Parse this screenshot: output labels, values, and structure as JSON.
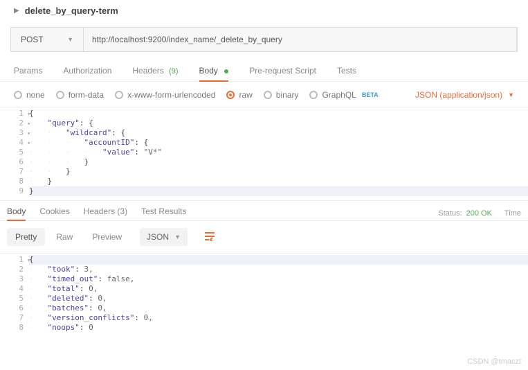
{
  "breadcrumb": {
    "title": "delete_by_query-term"
  },
  "request": {
    "method": "POST",
    "url": "http://localhost:9200/index_name/_delete_by_query"
  },
  "tabs": {
    "params": "Params",
    "auth": "Authorization",
    "headers": "Headers",
    "headers_count": "(9)",
    "body": "Body",
    "prerequest": "Pre-request Script",
    "tests": "Tests"
  },
  "bodyTypes": {
    "none": "none",
    "formdata": "form-data",
    "urlencoded": "x-www-form-urlencoded",
    "raw": "raw",
    "binary": "binary",
    "graphql": "GraphQL",
    "beta": "BETA",
    "contentType": "JSON (application/json)"
  },
  "reqEditor": {
    "lines": [
      "1",
      "2",
      "3",
      "4",
      "5",
      "6",
      "7",
      "8",
      "9"
    ],
    "code": [
      "{",
      "    \"query\": {",
      "        \"wildcard\": {",
      "            \"accountID\": {",
      "                \"value\": \"V*\"",
      "            }",
      "        }",
      "    }",
      "}"
    ]
  },
  "respTabs": {
    "body": "Body",
    "cookies": "Cookies",
    "headers": "Headers",
    "headers_count": "(3)",
    "test": "Test Results"
  },
  "status": {
    "label": "Status:",
    "code": "200 OK",
    "time_label": "Time"
  },
  "respToolbar": {
    "pretty": "Pretty",
    "raw": "Raw",
    "preview": "Preview",
    "json": "JSON"
  },
  "respEditor": {
    "lines": [
      "1",
      "2",
      "3",
      "4",
      "5",
      "6",
      "7",
      "8"
    ],
    "code": [
      "{",
      "    \"took\": 3,",
      "    \"timed_out\": false,",
      "    \"total\": 0,",
      "    \"deleted\": 0,",
      "    \"batches\": 0,",
      "    \"version_conflicts\": 0,",
      "    \"noops\": 0"
    ]
  },
  "watermark": "CSDN @tmaczt"
}
